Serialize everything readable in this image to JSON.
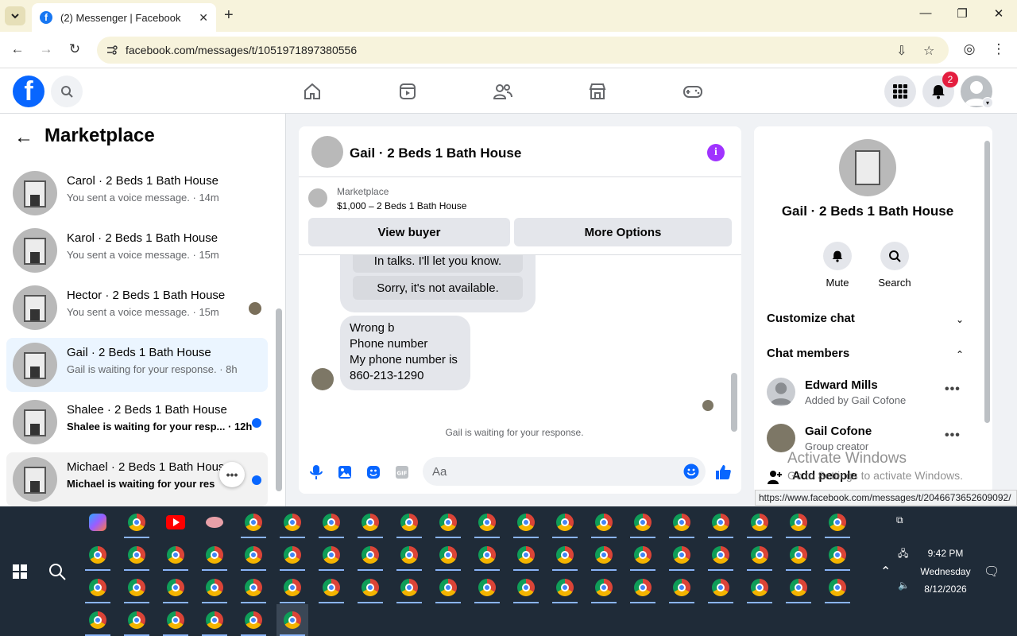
{
  "browser": {
    "tab_title": "(2) Messenger | Facebook",
    "tab_favicon": "f",
    "url": "facebook.com/messages/t/1051971897380556",
    "status_url": "https://www.facebook.com/messages/t/2046673652609092/"
  },
  "header": {
    "logo": "f",
    "notification_count": "2",
    "nav_icons": [
      "home-icon",
      "video-icon",
      "friends-icon",
      "marketplace-icon",
      "gaming-icon"
    ]
  },
  "sidebar": {
    "title": "Marketplace",
    "conversations": [
      {
        "name": "Carol · 2 Beds 1 Bath House",
        "preview": "You sent a voice message. · 14m",
        "unread": false
      },
      {
        "name": "Karol · 2 Beds 1 Bath House",
        "preview": "You sent a voice message. · 15m",
        "unread": false
      },
      {
        "name": "Hector · 2 Beds 1 Bath House",
        "preview": "You sent a voice message. · 15m",
        "unread": false
      },
      {
        "name": "Gail · 2 Beds 1 Bath House",
        "preview": "Gail is waiting for your response. · 8h",
        "unread": false
      },
      {
        "name": "Shalee · 2 Beds 1 Bath House",
        "preview": "Shalee is waiting for your resp... · 12h",
        "unread": true
      },
      {
        "name": "Michael · 2 Beds 1 Bath Hous",
        "preview": "Michael is waiting for your res...",
        "unread": true
      }
    ]
  },
  "chat": {
    "title": "Gail · 2 Beds 1 Bath House",
    "marketplace_label": "Marketplace",
    "listing": "$1,000 – 2 Beds 1 Bath House",
    "view_buyer": "View buyer",
    "more_options": "More Options",
    "quick_reply_1": "In talks. I'll let you know.",
    "quick_reply_2": "Sorry, it's not available.",
    "message_lines": [
      "Wrong b",
      "Phone number",
      "My phone number is",
      "860-213-1290"
    ],
    "waiting_text": "Gail is waiting for your response.",
    "composer_placeholder": "Aa"
  },
  "details": {
    "name": "Gail · 2 Beds 1 Bath House",
    "mute": "Mute",
    "search": "Search",
    "customize_chat": "Customize chat",
    "chat_members": "Chat members",
    "members": [
      {
        "name": "Edward Mills",
        "sub": "Added by Gail Cofone"
      },
      {
        "name": "Gail Cofone",
        "sub": "Group creator"
      }
    ],
    "add_people": "Add people",
    "activate_title": "Activate Windows",
    "activate_sub": "Go to Settings to activate Windows."
  },
  "taskbar": {
    "time": "9:42 PM",
    "day": "Wednesday",
    "date": "8/12/2026"
  },
  "colors": {
    "facebook_blue": "#0866ff",
    "messenger_purple": "#a033ff",
    "notification_red": "#e41e3f",
    "taskbar": "#1f2b38"
  }
}
